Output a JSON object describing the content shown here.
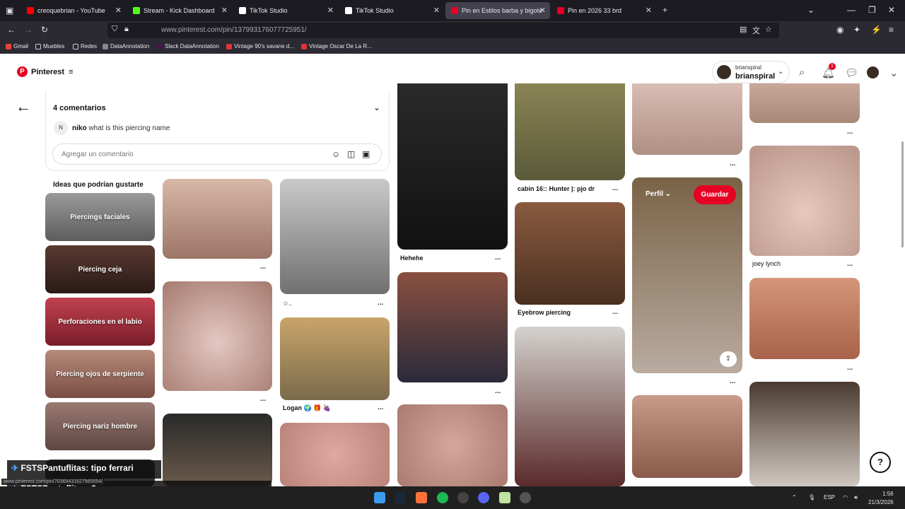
{
  "browser": {
    "tabs": [
      {
        "label": "creoquebrian - YouTube",
        "color": "#ff0000"
      },
      {
        "label": "Stream - Kick Dashboard",
        "color": "#53fc18"
      },
      {
        "label": "TikTok Studio",
        "color": "#ffffff"
      },
      {
        "label": "TikTok Studio",
        "color": "#ffffff"
      },
      {
        "label": "Pin en Estilos barba y bigote",
        "color": "#e60023"
      },
      {
        "label": "Pin en 2026 33 brd",
        "color": "#e60023"
      }
    ],
    "url": "www.pinterest.com/pin/137993176077725951/",
    "bookmarks": [
      "Gmail",
      "Muebles",
      "Redes",
      "DataAnnotation",
      "Slack DataAnnotation",
      "Vintage 90's savane d...",
      "Vintage Oscar De La R..."
    ]
  },
  "header": {
    "logo_text": "Pinterest",
    "user_small": "brianspiral",
    "user_big": "brianspiral",
    "notification_count": "1"
  },
  "comments": {
    "title": "4 comentarios",
    "avatar_letter": "N",
    "author": "niko",
    "text": "what is this piercing name",
    "placeholder": "Agregar un comentario"
  },
  "ideas": {
    "title": "Ideas que podrían gustarte",
    "items": [
      "Piercings faciales",
      "Piercing ceja",
      "Perforaciones en el labio",
      "Piercing ojos de serpiente",
      "Piercing nariz hombre"
    ]
  },
  "pins": {
    "labels": {
      "hehehe": "Hehehe",
      "cabin": "cabin 16:: Hunter |: pjo dr",
      "eyebrow": "Eyebrow piercing",
      "joey": "joey lynch",
      "logan": "Logan 🌍 🎁 🍇",
      "star": "☆.."
    },
    "perfil": "Perfil",
    "guardar": "Guardar",
    "more": "..."
  },
  "overlay": {
    "chat1": "FSTSPantuflitas: tipo ferrari",
    "chat2": "FSTSPantuflitas: ?",
    "status_url": "www.pinterest.com/pin/703694316279655​54/"
  },
  "taskbar": {
    "lang": "ESP",
    "time": "1:56",
    "date": "21/3/2026"
  }
}
